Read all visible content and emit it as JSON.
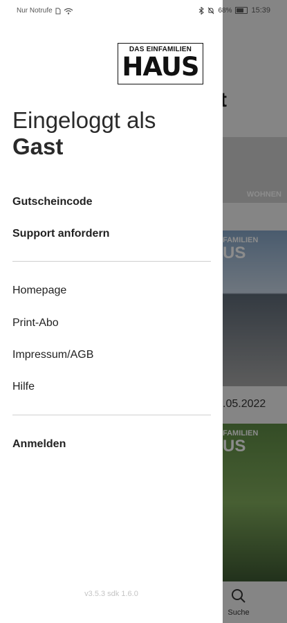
{
  "status_bar": {
    "carrier": "Nur Notrufe",
    "battery": "68%",
    "time": "15:39"
  },
  "background": {
    "heading_fragment": "t",
    "tile_label": "WOHNEN",
    "cover_logo_top": "FAMILIEN",
    "cover_logo_main": "US",
    "date_fragment": ".05.2022",
    "tab_label": "Suche"
  },
  "drawer": {
    "logo": {
      "top": "DAS EINFAMILIEN",
      "main": "HAUS"
    },
    "greeting": {
      "line1": "Eingeloggt als",
      "line2": "Gast"
    },
    "primary_items": [
      {
        "label": "Gutscheincode"
      },
      {
        "label": "Support anfordern"
      }
    ],
    "secondary_items": [
      {
        "label": "Homepage"
      },
      {
        "label": "Print-Abo"
      },
      {
        "label": "Impressum/AGB"
      },
      {
        "label": "Hilfe"
      }
    ],
    "login_label": "Anmelden",
    "version": "v3.5.3 sdk 1.6.0"
  }
}
